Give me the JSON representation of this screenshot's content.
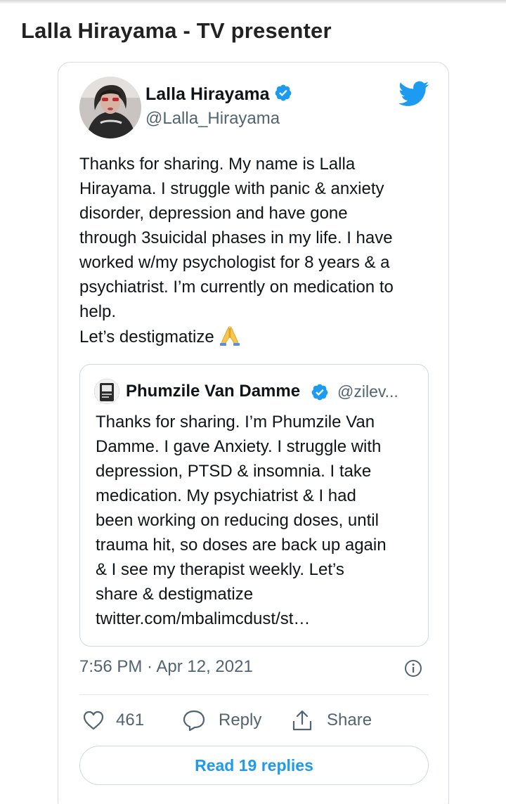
{
  "page": {
    "title": "Lalla Hirayama - TV presenter"
  },
  "tweet": {
    "author_name": "Lalla Hirayama",
    "author_handle": "@Lalla_Hirayama",
    "verified": true,
    "text": "Thanks for sharing. My name is Lalla\nHirayama. I struggle with panic & anxiety\ndisorder, depression and have gone\nthrough 3suicidal phases in my life. I have\nworked w/my psychologist for 8 years & a\npsychiatrist. I’m currently on medication to\nhelp.\nLet’s destigmatize",
    "emoji": "folded-hands",
    "timestamp": "7:56 PM · Apr 12, 2021",
    "likes": "461",
    "reply_label": "Reply",
    "share_label": "Share",
    "read_replies_label": "Read 19 replies"
  },
  "quoted_tweet": {
    "author_name": "Phumzile Van Damme",
    "author_handle": "@zilev...",
    "verified": true,
    "text": "Thanks for sharing. I’m Phumzile Van\nDamme. I gave Anxiety. I struggle with\ndepression, PTSD & insomnia. I take\nmedication. My psychiatrist & I had\nbeen working on reducing doses, until\ntrauma hit, so doses are back up again\n& I see my therapist weekly. Let’s\nshare & destigmatize\ntwitter.com/mbalimcdust/st…"
  },
  "icons": {
    "brand": "twitter-bird-icon",
    "verified": "verified-badge-icon",
    "like": "heart-icon",
    "reply": "reply-bubble-icon",
    "share": "share-upload-icon",
    "info": "info-icon"
  },
  "colors": {
    "accent": "#1d9bf0",
    "text_primary": "#0f1419",
    "text_secondary": "#536471",
    "border": "#cfd9de"
  }
}
